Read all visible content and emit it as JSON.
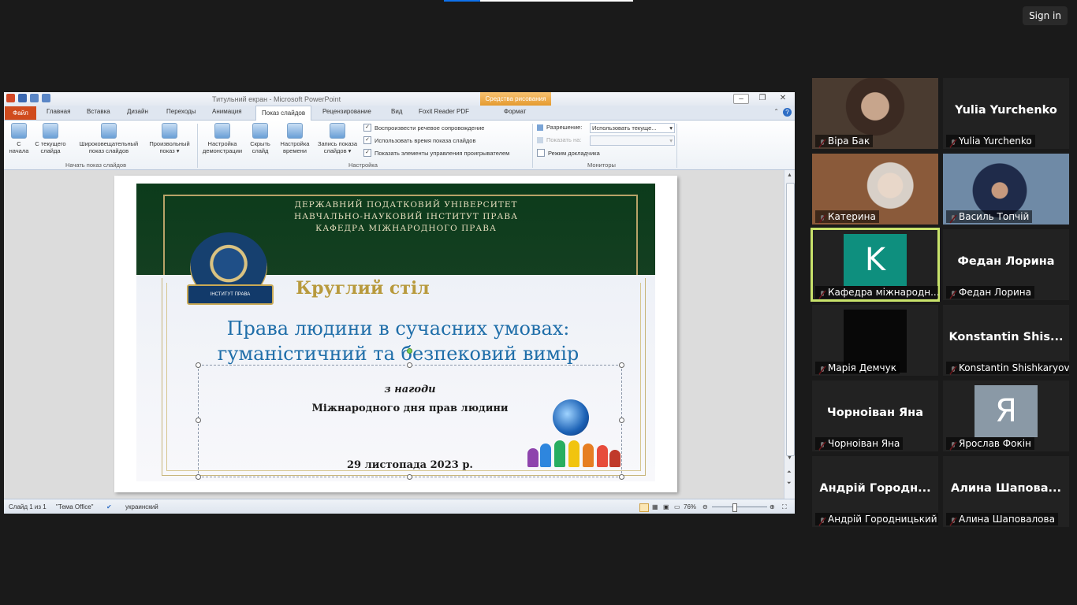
{
  "app": {
    "sign_in_label": "Sign in"
  },
  "powerpoint": {
    "window_title": "Титульний екран  -  Microsoft PowerPoint",
    "context_tab_group": "Средства рисования",
    "tabs": [
      "Файл",
      "Главная",
      "Вставка",
      "Дизайн",
      "Переходы",
      "Анимация",
      "Показ слайдов",
      "Рецензирование",
      "Вид",
      "Foxit Reader PDF",
      "Формат"
    ],
    "active_tab": "Показ слайдов",
    "ribbon": {
      "start_group": {
        "label": "Начать показ слайдов",
        "buttons": [
          {
            "line1": "С",
            "line2": "начала"
          },
          {
            "line1": "С текущего",
            "line2": "слайда"
          },
          {
            "line1": "Широковещательный",
            "line2": "показ слайдов"
          },
          {
            "line1": "Произвольный",
            "line2": "показ ▾"
          }
        ]
      },
      "setup_group": {
        "label": "Настройка",
        "buttons": [
          {
            "line1": "Настройка",
            "line2": "демонстрации"
          },
          {
            "line1": "Скрыть",
            "line2": "слайд"
          },
          {
            "line1": "Настройка",
            "line2": "времени"
          },
          {
            "line1": "Запись показа",
            "line2": "слайдов ▾"
          }
        ],
        "checkboxes": [
          {
            "label": "Воспроизвести речевое сопровождение",
            "checked": true
          },
          {
            "label": "Использовать время показа слайдов",
            "checked": true
          },
          {
            "label": "Показать элементы управления проигрывателем",
            "checked": true
          }
        ]
      },
      "monitors_group": {
        "label": "Мониторы",
        "resolution_label": "Разрешение:",
        "resolution_value": "Использовать текуще...",
        "show_on_label": "Показать на:",
        "show_on_value": "",
        "presenter_mode_label": "Режим докладчика",
        "presenter_mode_checked": false
      }
    },
    "slide": {
      "university_lines": [
        "ДЕРЖАВНИЙ ПОДАТКОВИЙ УНІВЕРСИТЕТ",
        "НАВЧАЛЬНО-НАУКОВИЙ ІНСТИТУТ ПРАВА",
        "КАФЕДРА МІЖНАРОДНОГО ПРАВА"
      ],
      "emblem_caption": "ІНСТИТУТ ПРАВА",
      "round_table": "Круглий стіл",
      "title_line1": "Права людини в сучасних умовах:",
      "title_line2": "гуманістичний та безпековий вимір",
      "occasion": "з нагоди",
      "day": "Міжнародного дня прав людини",
      "date": "29 листопада 2023 р."
    },
    "status_bar": {
      "slide_info": "Слайд 1 из 1",
      "theme": "\"Тема Office\"",
      "language": "украинский",
      "zoom": "76%"
    }
  },
  "participants": [
    {
      "name": "Віра Бак",
      "type": "video",
      "muted": true
    },
    {
      "name": "Yulia Yurchenko",
      "display": "Yulia Yurchenko",
      "type": "name",
      "muted": true
    },
    {
      "name": "Катерина",
      "type": "video",
      "muted": true
    },
    {
      "name": "Василь Топчій",
      "type": "video",
      "muted": true
    },
    {
      "name": "Кафедра міжнародн...",
      "type": "avatar",
      "initial": "K",
      "avatar_color": "#0e8f7e",
      "muted": true,
      "active_speaker": true
    },
    {
      "name": "Федан Лорина",
      "display": "Федан Лорина",
      "type": "name",
      "muted": true
    },
    {
      "name": "Марія Демчук",
      "type": "video",
      "muted": true
    },
    {
      "name": "Konstantin Shishkaryov",
      "display": "Konstantin  Shis...",
      "type": "name",
      "muted": true
    },
    {
      "name": "Чорноіван Яна",
      "display": "Чорноіван Яна",
      "type": "name",
      "muted": true
    },
    {
      "name": "Ярослав Фокін",
      "type": "avatar",
      "initial": "Я",
      "avatar_color": "#8a99a6",
      "muted": true
    },
    {
      "name": "Андрій Городницький",
      "display": "Андрій  Городн...",
      "type": "name",
      "muted": true
    },
    {
      "name": "Алина Шаповалова",
      "display": "Алина  Шапова...",
      "type": "name",
      "muted": true
    }
  ]
}
